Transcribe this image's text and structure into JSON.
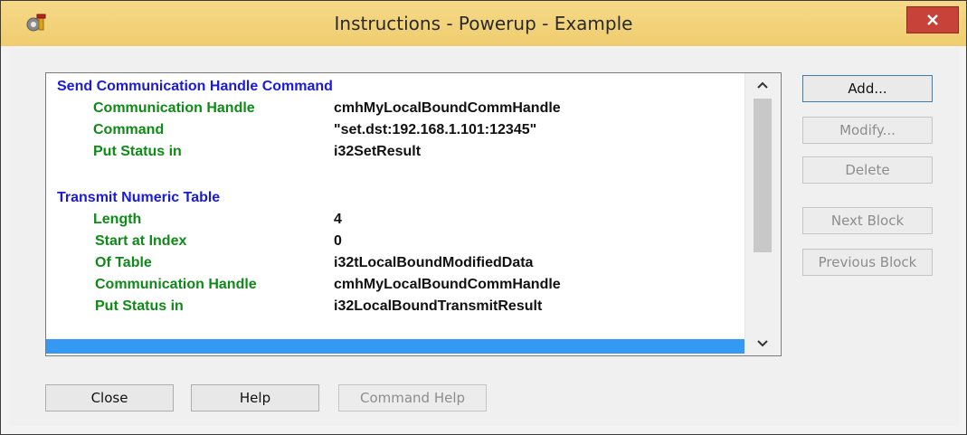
{
  "window": {
    "title": "Instructions - Powerup - Example",
    "close_icon": "close-icon",
    "app_icon": "gear-wrench-icon"
  },
  "instructions": {
    "blocks": [
      {
        "title": "Send Communication Handle Command",
        "params": [
          {
            "label": "Communication Handle",
            "value": "cmhMyLocalBoundCommHandle"
          },
          {
            "label": "Command",
            "value": "\"set.dst:192.168.1.101:12345\""
          },
          {
            "label": "Put Status in",
            "value": "i32SetResult"
          }
        ]
      },
      {
        "title": "Transmit Numeric Table",
        "params": [
          {
            "label": "Length",
            "value": "4"
          },
          {
            "label": "Start at Index",
            "value": "0"
          },
          {
            "label": "Of Table",
            "value": "i32tLocalBoundModifiedData"
          },
          {
            "label": "Communication Handle",
            "value": "cmhMyLocalBoundCommHandle"
          },
          {
            "label": "Put Status in",
            "value": "i32LocalBoundTransmitResult"
          }
        ]
      }
    ]
  },
  "side_buttons": {
    "add": "Add...",
    "modify": "Modify...",
    "delete": "Delete",
    "next_block": "Next Block",
    "previous_block": "Previous Block"
  },
  "bottom_buttons": {
    "close": "Close",
    "help": "Help",
    "command_help": "Command Help"
  },
  "colors": {
    "block_title": "#1a1adb",
    "param_label": "#0e8a16",
    "selection": "#3399f3",
    "close_button": "#c7433a"
  }
}
